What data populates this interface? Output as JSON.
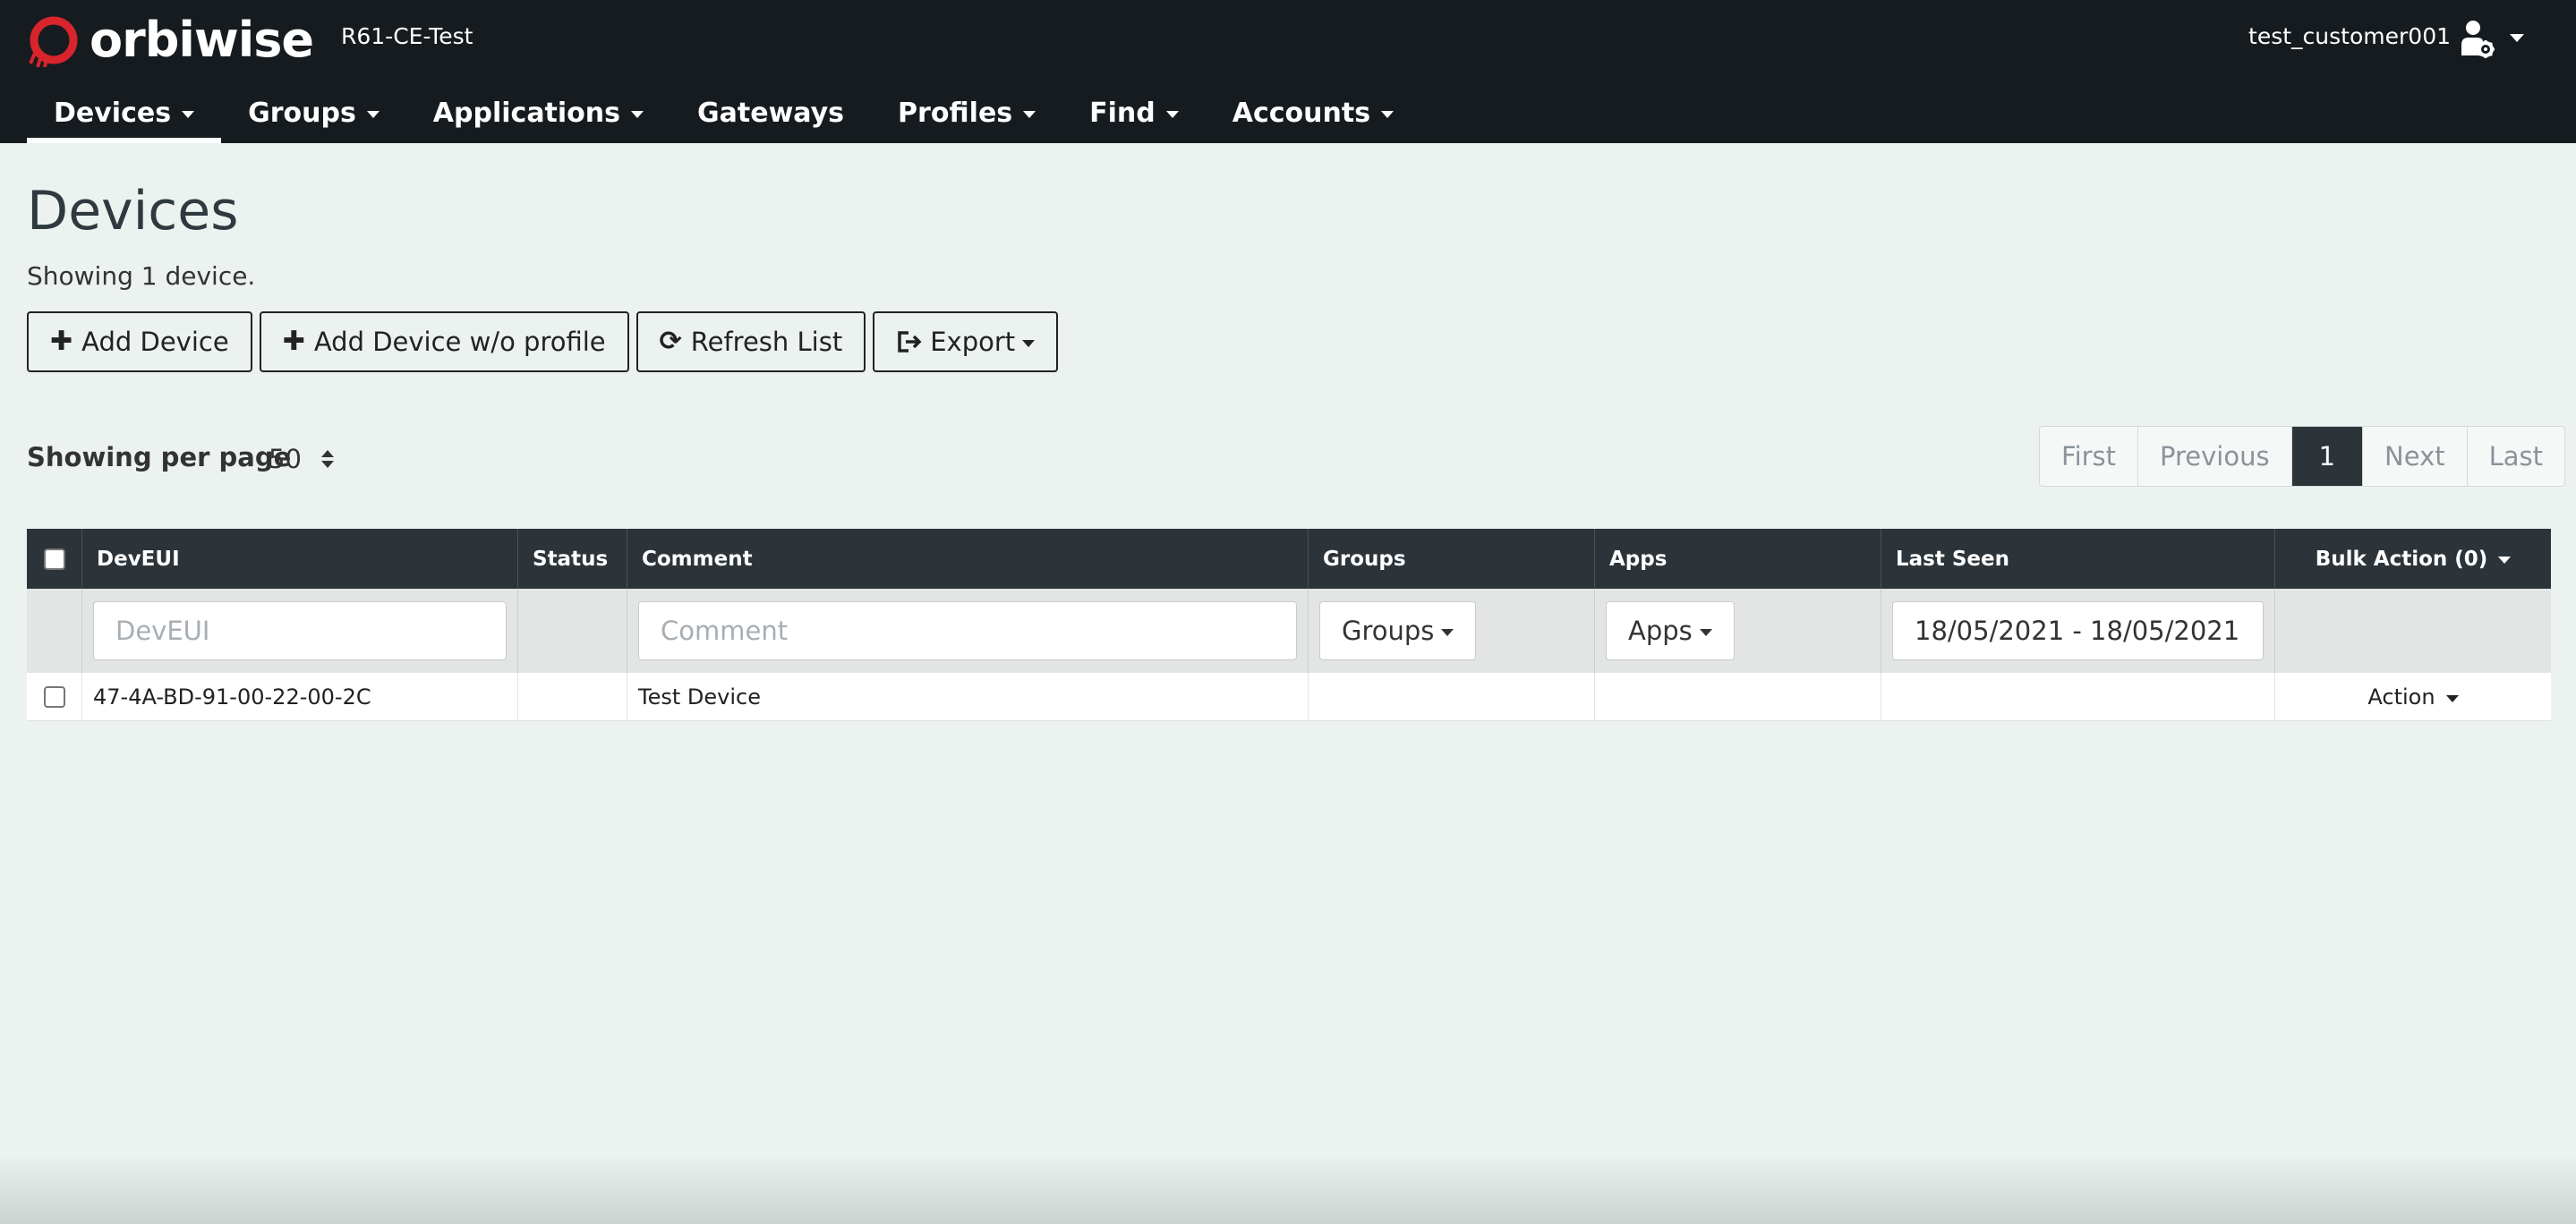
{
  "header": {
    "brand": "orbiwise",
    "environment": "R61-CE-Test",
    "user": "test_customer001",
    "user_icon": "user-gear-icon",
    "logo_color": "#d8242c"
  },
  "nav": {
    "items": [
      {
        "label": "Devices",
        "dropdown": true,
        "active": true
      },
      {
        "label": "Groups",
        "dropdown": true
      },
      {
        "label": "Applications",
        "dropdown": true
      },
      {
        "label": "Gateways",
        "dropdown": false
      },
      {
        "label": "Profiles",
        "dropdown": true
      },
      {
        "label": "Find",
        "dropdown": true
      },
      {
        "label": "Accounts",
        "dropdown": true
      }
    ]
  },
  "page": {
    "title": "Devices",
    "showing": "Showing 1 device."
  },
  "toolbar": {
    "add_device": "Add Device",
    "add_device_no_profile": "Add Device w/o profile",
    "refresh": "Refresh List",
    "export": "Export"
  },
  "perpage": {
    "label": "Showing per page",
    "value": "50"
  },
  "pagination": {
    "first": "First",
    "previous": "Previous",
    "current": "1",
    "next": "Next",
    "last": "Last"
  },
  "table": {
    "headers": {
      "deveui": "DevEUI",
      "status": "Status",
      "comment": "Comment",
      "groups": "Groups",
      "apps": "Apps",
      "last_seen": "Last Seen",
      "bulk_action": "Bulk Action (0)"
    },
    "filters": {
      "deveui_placeholder": "DevEUI",
      "comment_placeholder": "Comment",
      "groups": "Groups",
      "apps": "Apps",
      "date_range": "18/05/2021 - 18/05/2021"
    },
    "rows": [
      {
        "deveui": "47-4A-BD-91-00-22-00-2C",
        "status": "",
        "comment": "Test Device",
        "groups": "",
        "apps": "",
        "last_seen": "",
        "action": "Action"
      }
    ]
  }
}
